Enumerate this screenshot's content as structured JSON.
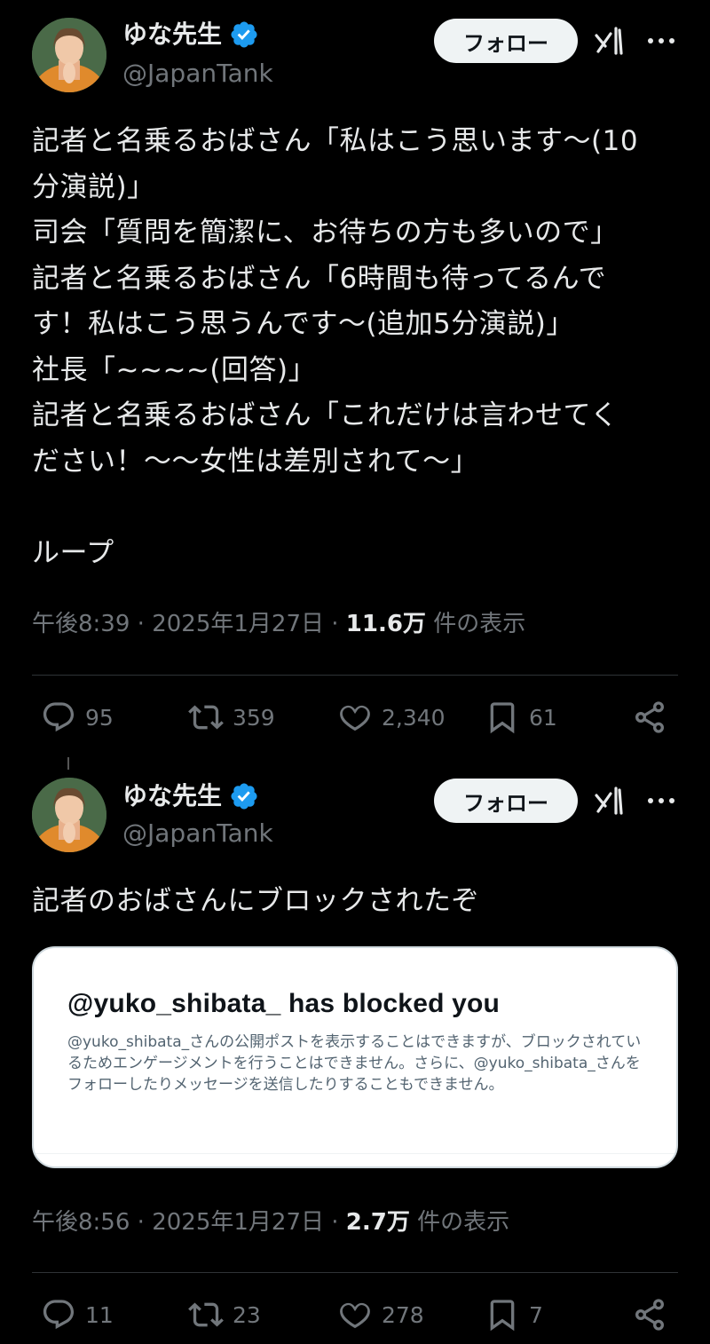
{
  "tweets": [
    {
      "author": {
        "name": "ゆな先生",
        "handle": "@JapanTank"
      },
      "follow_label": "フォロー",
      "text": "記者と名乗るおばさん「私はこう思います〜(10\n分演説)」\n司会「質問を簡潔に、お待ちの方も多いので」\n記者と名乗るおばさん「6時間も待ってるんで\nす！私はこう思うんです〜(追加5分演説)」\n社長「~~~~(回答)」\n記者と名乗るおばさん「これだけは言わせてく\nださい！〜〜女性は差別されて〜」\n\nループ",
      "time": "午後8:39",
      "date": "2025年1月27日",
      "views": "11.6万",
      "views_label": "件の表示",
      "stats": {
        "replies": "95",
        "reposts": "359",
        "likes": "2,340",
        "bookmarks": "61"
      }
    },
    {
      "author": {
        "name": "ゆな先生",
        "handle": "@JapanTank"
      },
      "follow_label": "フォロー",
      "text": "記者のおばさんにブロックされたぞ",
      "card": {
        "title": "@yuko_shibata_ has blocked you",
        "description": "@yuko_shibata_さんの公開ポストを表示することはできますが、ブロックされているためエンゲージメントを行うことはできません。さらに、@yuko_shibata_さんをフォローしたりメッセージを送信したりすることもできません。"
      },
      "time": "午後8:56",
      "date": "2025年1月27日",
      "views": "2.7万",
      "views_label": "件の表示",
      "stats": {
        "replies": "11",
        "reposts": "23",
        "likes": "278",
        "bookmarks": "7"
      }
    }
  ],
  "separator": "·",
  "colors": {
    "background": "#000000",
    "text": "#e7e9ea",
    "secondary": "#71767b",
    "verified": "#1d9bf0"
  },
  "icons": [
    "verified-badge-icon",
    "grok-icon",
    "more-icon",
    "reply-icon",
    "repost-icon",
    "like-icon",
    "bookmark-icon",
    "share-icon"
  ]
}
